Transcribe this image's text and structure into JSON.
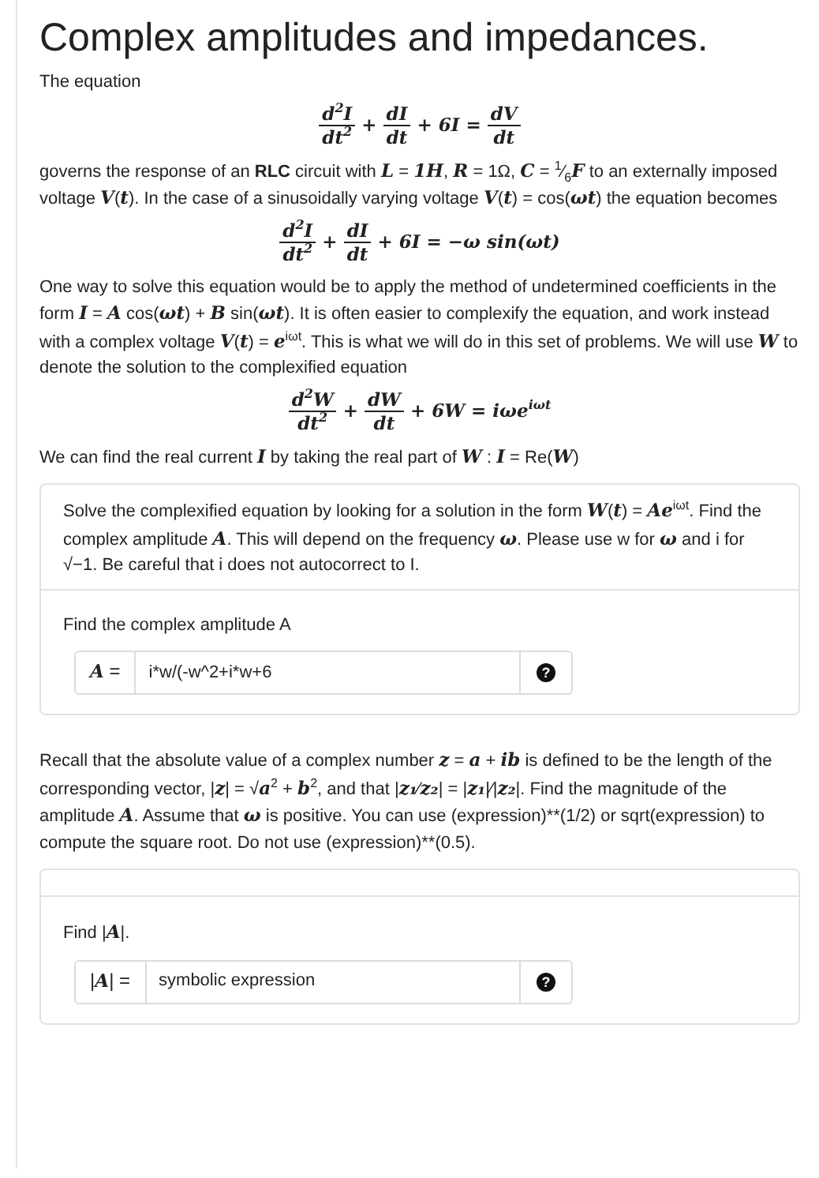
{
  "title": "Complex amplitudes and impedances.",
  "content": [
    {
      "kind": "paragraph",
      "text": "The equation"
    },
    {
      "kind": "equation",
      "terms": [
        {
          "kind": "frac",
          "num": "d$^{2}$I",
          "den": "dt$^{2}$"
        },
        {
          "kind": "op",
          "text": "+"
        },
        {
          "kind": "frac",
          "num": "dI",
          "den": "dt"
        },
        {
          "kind": "op",
          "text": "+ 6I ="
        },
        {
          "kind": "frac",
          "num": "dV",
          "den": "dt"
        }
      ]
    },
    {
      "kind": "paragraph",
      "text": "governs the response of an **RLC** circuit with *L* = *1H*, *R* = 1Ω, *C* = $^{1}$⁄$_{6}$*F* to an externally imposed voltage *V*(*t*). In the case of a sinusoidally varying voltage *V*(*t*) = cos(*ωt*) the equation becomes"
    },
    {
      "kind": "equation",
      "terms": [
        {
          "kind": "frac",
          "num": "d$^{2}$I",
          "den": "dt$^{2}$"
        },
        {
          "kind": "op",
          "text": "+"
        },
        {
          "kind": "frac",
          "num": "dI",
          "den": "dt"
        },
        {
          "kind": "op",
          "text": "+ 6I = −ω sin(ωt)"
        }
      ]
    },
    {
      "kind": "paragraph",
      "text": "One way to solve this equation would be to apply the method of undetermined coefficients in the form *I* = *A* cos(*ωt*) + *B* sin(*ωt*). It is often easier to complexify the equation, and work instead with a complex voltage *V*(*t*) = *e*$^{iωt}$. This is what we will do in this set of problems. We will use *W* to denote the solution to the complexified equation"
    },
    {
      "kind": "equation",
      "terms": [
        {
          "kind": "frac",
          "num": "d$^{2}$W",
          "den": "dt$^{2}$"
        },
        {
          "kind": "op",
          "text": "+"
        },
        {
          "kind": "frac",
          "num": "dW",
          "den": "dt"
        },
        {
          "kind": "op",
          "text": "+ 6W = iωe$^{iωt}$"
        }
      ]
    },
    {
      "kind": "paragraph",
      "text": "We can find the real current *I* by taking the real part of *W* : *I* = Re(*W*)"
    },
    {
      "kind": "question",
      "prompt": "Solve the complexified equation by looking for a solution in the form *W*(*t*) = *Ae*$^{iωt}$. Find the complex amplitude *A*. This will depend on the frequency *ω*. Please use w for *ω* and i for √−1. Be careful that i does not autocorrect to I.",
      "label": "Find the complex amplitude A",
      "prefix": "*A* =",
      "value": "i*w/(-w^2+i*w+6",
      "help": "?"
    },
    {
      "kind": "paragraph",
      "text": "Recall that the absolute value of a complex number *z* = *a* + *ib* is defined to be the length of the corresponding vector, |*z*| = √*a*$^{2}$ + *b*$^{2}$, and that |*z₁*⁄*z₂*| = |*z₁*|⁄|*z₂*|. Find the magnitude of the amplitude *A*. Assume that *ω* is positive.",
      "tail": " You can use (expression)**(1/2) or sqrt(expression) to compute the square root. Do not use (expression)**(0.5)."
    },
    {
      "kind": "question",
      "label": "Find |*A*|.",
      "prefix": "|*A*| =",
      "placeholder": "symbolic expression",
      "help": "?"
    }
  ]
}
